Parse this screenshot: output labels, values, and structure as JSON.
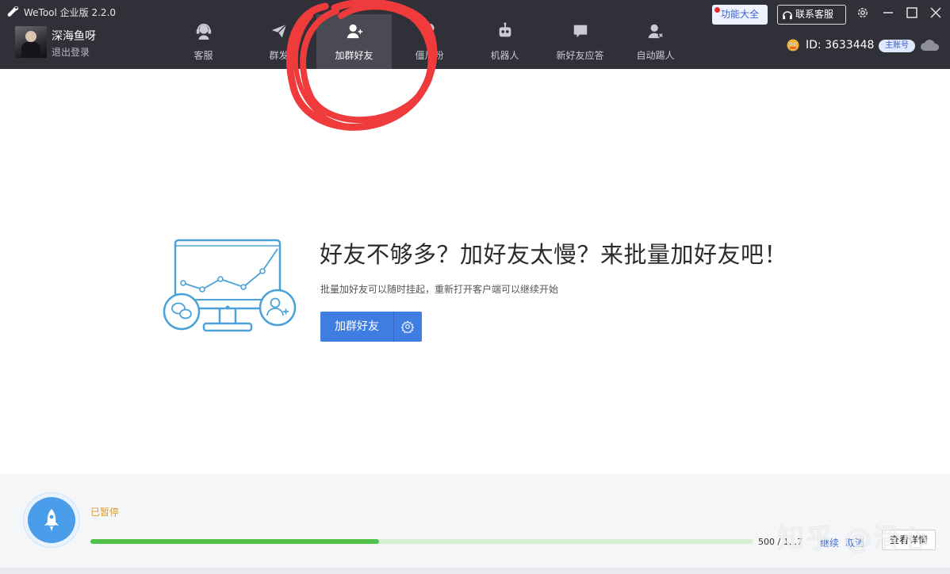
{
  "app": {
    "title": "WeTool 企业版 2.2.0",
    "icon": "wrench-icon"
  },
  "user": {
    "name": "深海鱼呀",
    "logout": "退出登录"
  },
  "nav": {
    "items": [
      {
        "label": "客服",
        "icon": "customer-service-icon",
        "active": false
      },
      {
        "label": "群发",
        "icon": "send-icon",
        "active": false
      },
      {
        "label": "加群好友",
        "icon": "add-friend-icon",
        "active": true
      },
      {
        "label": "僵尸粉",
        "icon": "zombie-icon",
        "active": false
      },
      {
        "label": "机器人",
        "icon": "robot-icon",
        "active": false
      },
      {
        "label": "新好友应答",
        "icon": "chat-bubble-icon",
        "active": false
      },
      {
        "label": "自动踢人",
        "icon": "kick-user-icon",
        "active": false
      }
    ]
  },
  "header": {
    "features_label": "功能大全",
    "support_label": "联系客服",
    "id_text": "ID: 3633448",
    "account_badge": "主账号"
  },
  "main": {
    "headline": "好友不够多？加好友太慢？来批量加好友吧！",
    "subtext": "批量加好友可以随时挂起，重新打开客户端可以继续开始",
    "action_label": "加群好友"
  },
  "status": {
    "state": "已暂停",
    "progress_fraction": 0.435,
    "count_text": "500 / 1...7",
    "continue_label": "继续",
    "cancel_label": "取消",
    "details_label": "查看详情"
  },
  "watermark": "知乎 @滑心",
  "colors": {
    "topbar": "#2f3038",
    "accent": "#3f7de3",
    "progress": "#52c24a",
    "paused": "#e09a2a",
    "annotation": "#ef3b3b"
  }
}
